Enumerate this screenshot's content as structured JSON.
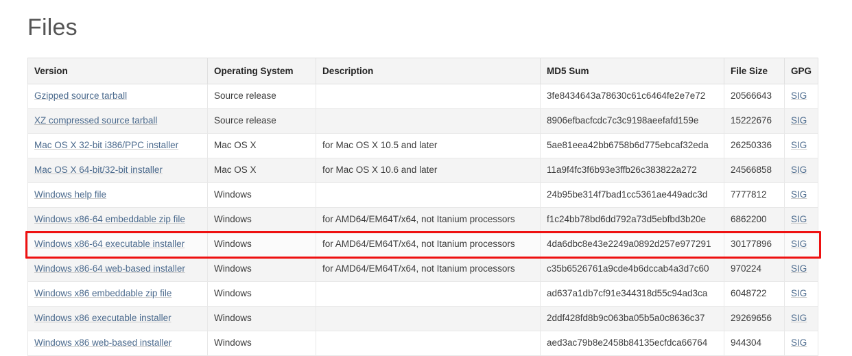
{
  "page": {
    "title": "Files"
  },
  "table": {
    "columns": [
      "Version",
      "Operating System",
      "Description",
      "MD5 Sum",
      "File Size",
      "GPG"
    ],
    "gpg_link_label": "SIG",
    "rows": [
      {
        "version": "Gzipped source tarball",
        "os": "Source release",
        "description": "",
        "md5": "3fe8434643a78630c61c6464fe2e7e72",
        "size": "20566643",
        "gpg": "SIG",
        "highlighted": false
      },
      {
        "version": "XZ compressed source tarball",
        "os": "Source release",
        "description": "",
        "md5": "8906efbacfcdc7c3c9198aeefafd159e",
        "size": "15222676",
        "gpg": "SIG",
        "highlighted": false
      },
      {
        "version": "Mac OS X 32-bit i386/PPC installer",
        "os": "Mac OS X",
        "description": "for Mac OS X 10.5 and later",
        "md5": "5ae81eea42bb6758b6d775ebcaf32eda",
        "size": "26250336",
        "gpg": "SIG",
        "highlighted": false
      },
      {
        "version": "Mac OS X 64-bit/32-bit installer",
        "os": "Mac OS X",
        "description": "for Mac OS X 10.6 and later",
        "md5": "11a9f4fc3f6b93e3ffb26c383822a272",
        "size": "24566858",
        "gpg": "SIG",
        "highlighted": false
      },
      {
        "version": "Windows help file",
        "os": "Windows",
        "description": "",
        "md5": "24b95be314f7bad1cc5361ae449adc3d",
        "size": "7777812",
        "gpg": "SIG",
        "highlighted": false
      },
      {
        "version": "Windows x86-64 embeddable zip file",
        "os": "Windows",
        "description": "for AMD64/EM64T/x64, not Itanium processors",
        "md5": "f1c24bb78bd6dd792a73d5ebfbd3b20e",
        "size": "6862200",
        "gpg": "SIG",
        "highlighted": false
      },
      {
        "version": "Windows x86-64 executable installer",
        "os": "Windows",
        "description": "for AMD64/EM64T/x64, not Itanium processors",
        "md5": "4da6dbc8e43e2249a0892d257e977291",
        "size": "30177896",
        "gpg": "SIG",
        "highlighted": true
      },
      {
        "version": "Windows x86-64 web-based installer",
        "os": "Windows",
        "description": "for AMD64/EM64T/x64, not Itanium processors",
        "md5": "c35b6526761a9cde4b6dccab4a3d7c60",
        "size": "970224",
        "gpg": "SIG",
        "highlighted": false
      },
      {
        "version": "Windows x86 embeddable zip file",
        "os": "Windows",
        "description": "",
        "md5": "ad637a1db7cf91e344318d55c94ad3ca",
        "size": "6048722",
        "gpg": "SIG",
        "highlighted": false
      },
      {
        "version": "Windows x86 executable installer",
        "os": "Windows",
        "description": "",
        "md5": "2ddf428fd8b9c063ba05b5a0c8636c37",
        "size": "29269656",
        "gpg": "SIG",
        "highlighted": false
      },
      {
        "version": "Windows x86 web-based installer",
        "os": "Windows",
        "description": "",
        "md5": "aed3ac79b8e2458b84135ecfdca66764",
        "size": "944304",
        "gpg": "SIG",
        "highlighted": false
      }
    ]
  },
  "annotation": {
    "highlight_color": "#ee1111",
    "target_row_version": "Windows x86-64 executable installer"
  }
}
